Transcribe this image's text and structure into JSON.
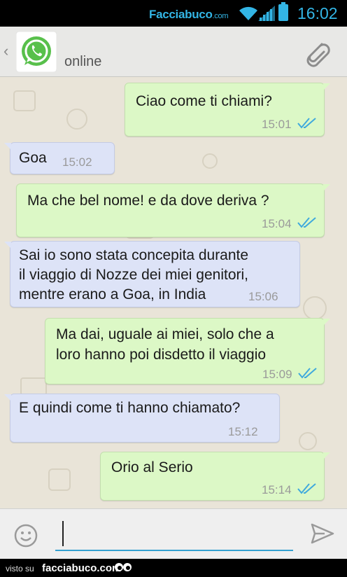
{
  "status_bar": {
    "watermark": "Facciabuco",
    "watermark_suffix": ".com",
    "clock": "16:02"
  },
  "header": {
    "back_icon": "chevron-left-icon",
    "avatar_icon": "whatsapp-logo",
    "status": "online",
    "attach_icon": "paperclip-icon"
  },
  "messages": [
    {
      "direction": "out",
      "text": "Ciao come ti chiami?",
      "time": "15:01",
      "read": true
    },
    {
      "direction": "in",
      "text": "Goa",
      "time": "15:02"
    },
    {
      "direction": "out",
      "text": "Ma che bel nome! e da dove deriva ?",
      "time": "15:04",
      "read": true
    },
    {
      "direction": "in",
      "text": "Sai io sono stata concepita durante\nil viaggio di Nozze dei miei genitori,\nmentre erano a Goa, in India",
      "time": "15:06"
    },
    {
      "direction": "out",
      "text": "Ma dai, uguale ai miei, solo che a\nloro hanno poi disdetto il viaggio",
      "time": "15:09",
      "read": true
    },
    {
      "direction": "in",
      "text": "E quindi come ti hanno chiamato?",
      "time": "15:12"
    },
    {
      "direction": "out",
      "text": "Orio al Serio",
      "time": "15:14",
      "read": true
    }
  ],
  "composer": {
    "value": "",
    "emoji_icon": "smiley-icon",
    "send_icon": "send-icon"
  },
  "footer": {
    "visto": "visto su",
    "brand": "facciabuco.com"
  },
  "colors": {
    "accent": "#33b5e5",
    "outgoing_bubble": "#dcf8c6",
    "incoming_bubble": "#dde3f7",
    "chat_background": "#e9e4d8",
    "read_ticks": "#3fa9dd"
  }
}
